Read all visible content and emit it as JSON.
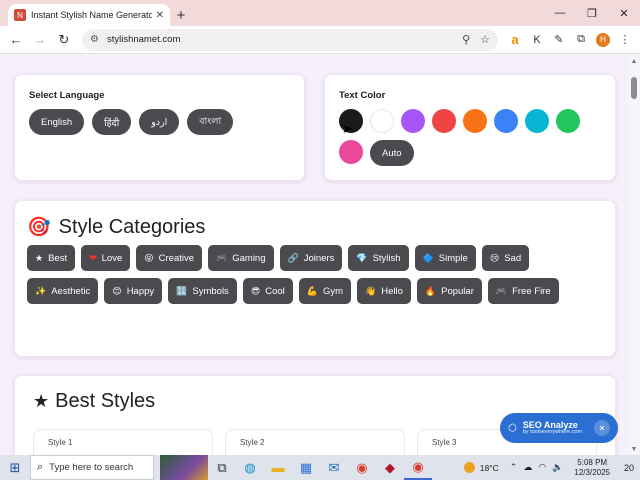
{
  "browser": {
    "tab": {
      "title": "Instant Stylish Name Generator",
      "favicon": "N"
    },
    "url": "stylishnamet.com",
    "profile_initial": "H"
  },
  "language_card": {
    "label": "Select Language",
    "languages": [
      "English",
      "हिंदी",
      "اردو",
      "বাংলা"
    ]
  },
  "text_color_card": {
    "label": "Text Color",
    "colors": [
      "#1a1a1a",
      "#ffffff",
      "#a855f7",
      "#ef4444",
      "#f97316",
      "#3b82f6",
      "#06b6d4",
      "#22c55e",
      "#ec4899"
    ],
    "auto_label": "Auto"
  },
  "categories_card": {
    "emoji": "🎯",
    "title": "Style Categories",
    "items": [
      {
        "icon": "★",
        "label": "Best"
      },
      {
        "icon": "❤",
        "label": "Love"
      },
      {
        "icon": "😝",
        "label": "Creative"
      },
      {
        "icon": "🎮",
        "label": "Gaming"
      },
      {
        "icon": "🔗",
        "label": "Joiners"
      },
      {
        "icon": "💎",
        "label": "Stylish"
      },
      {
        "icon": "🔷",
        "label": "Simple"
      },
      {
        "icon": "😢",
        "label": "Sad"
      },
      {
        "icon": "✨",
        "label": "Aesthetic"
      },
      {
        "icon": "😊",
        "label": "Happy"
      },
      {
        "icon": "🔣",
        "label": "Symbols"
      },
      {
        "icon": "😎",
        "label": "Cool"
      },
      {
        "icon": "💪",
        "label": "Gym"
      },
      {
        "icon": "👋",
        "label": "Hello"
      },
      {
        "icon": "🔥",
        "label": "Popular"
      },
      {
        "icon": "🎮",
        "label": "Free Fire"
      }
    ]
  },
  "best_styles": {
    "title": "Best Styles",
    "styles": [
      "Style 1",
      "Style 2",
      "Style 3"
    ]
  },
  "seo_widget": {
    "name": "SEO Analyze",
    "by": "by toolseverywhere.com"
  },
  "taskbar": {
    "search_placeholder": "Type here to search",
    "temperature": "18°C",
    "time": "5:08 PM",
    "date": "12/3/2025",
    "notification_count": "20"
  }
}
